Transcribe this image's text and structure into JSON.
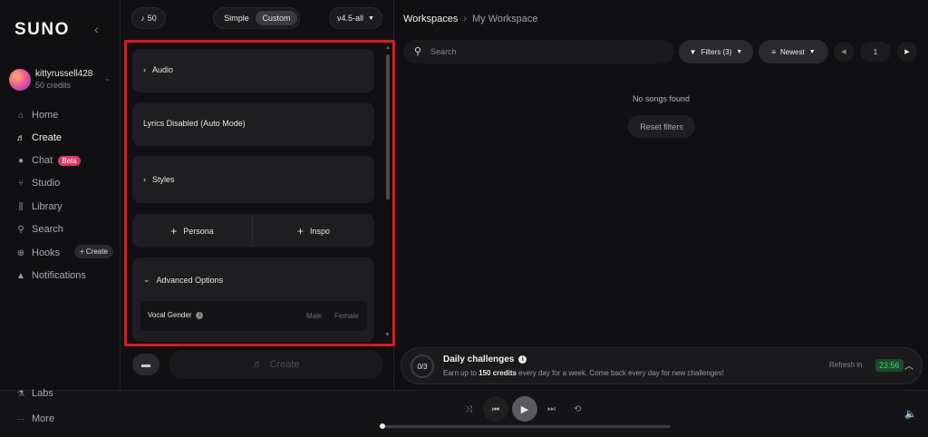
{
  "sidebar": {
    "logo": "SUNO",
    "collapse_icon": "chevron-left-icon",
    "user": {
      "name": "kittyrussell428",
      "credits": "50 credits"
    },
    "nav": [
      {
        "label": "Home",
        "icon": "home-icon"
      },
      {
        "label": "Create",
        "icon": "music-note-icon",
        "active": true
      },
      {
        "label": "Chat",
        "icon": "chat-icon",
        "badge": "Beta"
      },
      {
        "label": "Studio",
        "icon": "studio-icon"
      },
      {
        "label": "Library",
        "icon": "library-icon"
      },
      {
        "label": "Search",
        "icon": "search-icon"
      },
      {
        "label": "Hooks",
        "icon": "hooks-icon",
        "action": "+ Create"
      },
      {
        "label": "Notifications",
        "icon": "bell-icon"
      }
    ],
    "bottom": {
      "labs": "Labs",
      "more": "More"
    }
  },
  "create_panel": {
    "credits_count": "50",
    "mode": {
      "simple": "Simple",
      "custom": "Custom",
      "selected": "Custom"
    },
    "model": "v4.5-all",
    "sections": {
      "audio": "Audio",
      "lyrics": "Lyrics Disabled (Auto Mode)",
      "styles": "Styles",
      "persona": "Persona",
      "inspo": "Inspo",
      "advanced": "Advanced Options",
      "vocal_gender": {
        "label": "Vocal Gender",
        "options": [
          "Male",
          "Female"
        ]
      }
    },
    "create_label": "Create"
  },
  "workspace": {
    "breadcrumb": {
      "root": "Workspaces",
      "current": "My Workspace"
    },
    "search_placeholder": "Search",
    "filters_label": "Filters (3)",
    "sort_label": "Newest",
    "page": "1",
    "empty_message": "No songs found",
    "reset_label": "Reset filters",
    "challenge": {
      "count": "0/3",
      "title": "Daily challenges",
      "desc_prefix": "Earn up to ",
      "desc_bold": "150 credits",
      "desc_suffix": " every day for a week. Come back every day for new challenges!",
      "refresh_label": "Refresh in",
      "timer": "23:56"
    }
  },
  "colors": {
    "accent_red": "#e0161e",
    "beta": "#e2366b",
    "timer_green": "#46d36a"
  }
}
